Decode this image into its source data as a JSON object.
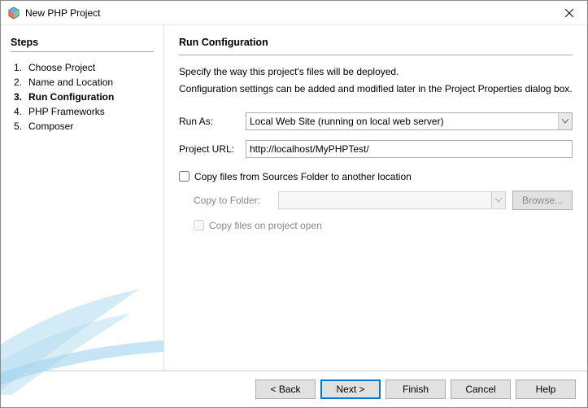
{
  "window": {
    "title": "New PHP Project"
  },
  "sidebar": {
    "heading": "Steps",
    "items": [
      {
        "num": "1.",
        "label": "Choose Project"
      },
      {
        "num": "2.",
        "label": "Name and Location"
      },
      {
        "num": "3.",
        "label": "Run Configuration"
      },
      {
        "num": "4.",
        "label": "PHP Frameworks"
      },
      {
        "num": "5.",
        "label": "Composer"
      }
    ],
    "current_index": 2
  },
  "main": {
    "heading": "Run Configuration",
    "desc1": "Specify the way this project's files will be deployed.",
    "desc2": "Configuration settings can be added and modified later in the Project Properties dialog box.",
    "run_as_label": "Run As:",
    "run_as_value": "Local Web Site (running on local web server)",
    "project_url_label": "Project URL:",
    "project_url_value": "http://localhost/MyPHPTest/",
    "copy_label": "Copy files from Sources Folder to another location",
    "copy_checked": false,
    "copy_to_label": "Copy to Folder:",
    "copy_to_value": "",
    "browse_label": "Browse...",
    "copy_on_open_label": "Copy files on project open",
    "copy_on_open_checked": false
  },
  "footer": {
    "back": "< Back",
    "next": "Next >",
    "finish": "Finish",
    "cancel": "Cancel",
    "help": "Help"
  }
}
